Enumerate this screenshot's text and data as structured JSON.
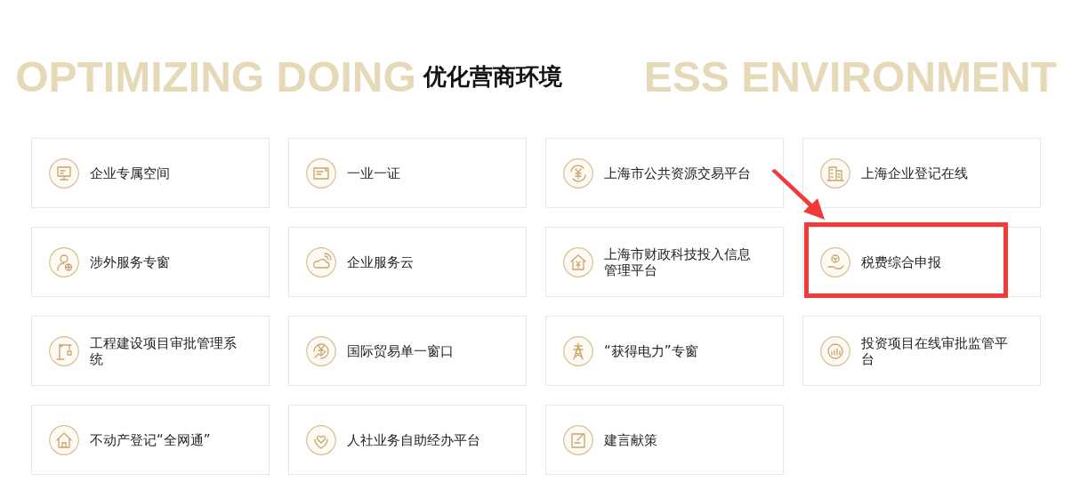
{
  "header": {
    "background_left": "OPTIMIZING DOING",
    "title": "优化营商环境",
    "background_right": "ESS ENVIRONMENT"
  },
  "items": [
    {
      "label": "企业专属空间",
      "highlighted": false
    },
    {
      "label": "一业一证",
      "highlighted": false
    },
    {
      "label": "上海市公共资源交易平台",
      "highlighted": false
    },
    {
      "label": "上海企业登记在线",
      "highlighted": false
    },
    {
      "label": "涉外服务专窗",
      "highlighted": false
    },
    {
      "label": "企业服务云",
      "highlighted": false
    },
    {
      "label": "上海市财政科技投入信息管理平台",
      "highlighted": false
    },
    {
      "label": "税费综合申报",
      "highlighted": true
    },
    {
      "label": "工程建设项目审批管理系统",
      "highlighted": false
    },
    {
      "label": "国际贸易单一窗口",
      "highlighted": false
    },
    {
      "label": "“获得电力”专窗",
      "highlighted": false
    },
    {
      "label": "投资项目在线审批监管平台",
      "highlighted": false
    },
    {
      "label": "不动产登记“全网通”",
      "highlighted": false
    },
    {
      "label": "人社业务自助经办平台",
      "highlighted": false
    },
    {
      "label": "建言献策",
      "highlighted": false
    }
  ]
}
